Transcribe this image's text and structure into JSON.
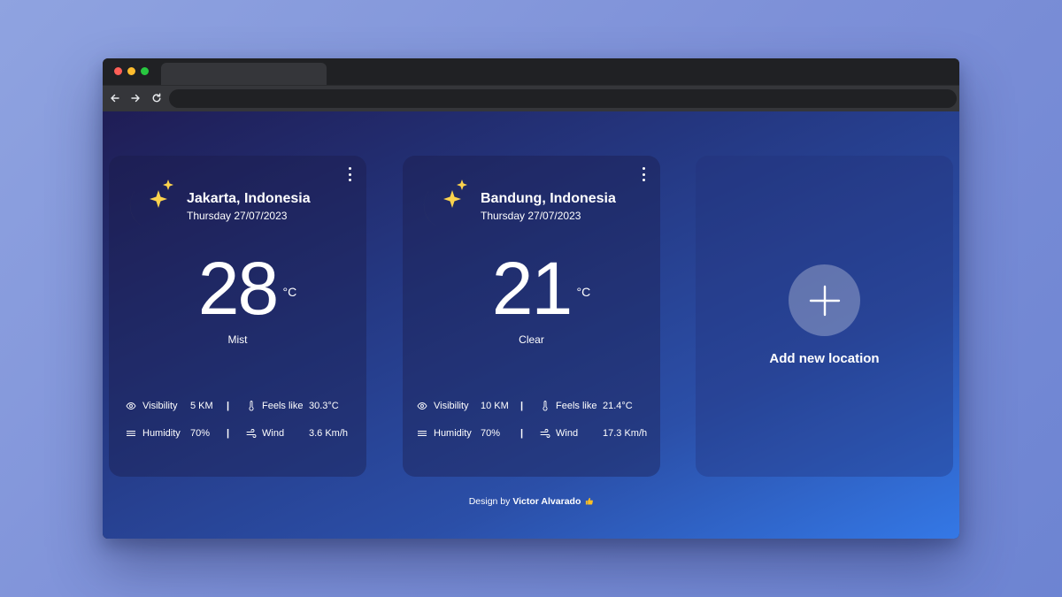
{
  "browser": {
    "buttons": {
      "back": "back-arrow-icon",
      "forward": "forward-arrow-icon",
      "reload": "reload-icon"
    },
    "url": ""
  },
  "colors": {
    "moon": "#fcd34d",
    "accent_gradient_start": "#1f1d55",
    "accent_gradient_end": "#3478e6"
  },
  "cards": [
    {
      "city": "Jakarta, Indonesia",
      "date": "Thursday 27/07/2023",
      "temperature": "28",
      "unit": "°C",
      "condition": "Mist",
      "stats": {
        "visibility_label": "Visibility",
        "visibility_value": "5 KM",
        "feels_label": "Feels like",
        "feels_value": "30.3°C",
        "humidity_label": "Humidity",
        "humidity_value": "70%",
        "wind_label": "Wind",
        "wind_value": "3.6 Km/h"
      }
    },
    {
      "city": "Bandung, Indonesia",
      "date": "Thursday 27/07/2023",
      "temperature": "21",
      "unit": "°C",
      "condition": "Clear",
      "stats": {
        "visibility_label": "Visibility",
        "visibility_value": "10 KM",
        "feels_label": "Feels like",
        "feels_value": "21.4°C",
        "humidity_label": "Humidity",
        "humidity_value": "70%",
        "wind_label": "Wind",
        "wind_value": "17.3 Km/h"
      }
    }
  ],
  "add_card": {
    "label": "Add new location"
  },
  "footer": {
    "prefix": "Design by",
    "author": "Victor Alvarado"
  },
  "separator": "|"
}
